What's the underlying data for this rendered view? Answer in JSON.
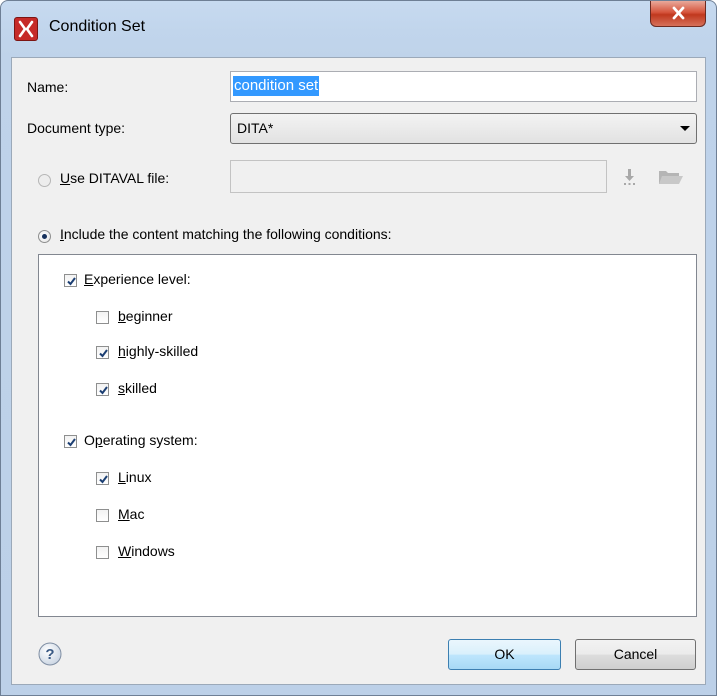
{
  "window": {
    "title": "Condition Set",
    "icons": {
      "app": "oxygen-x-icon",
      "close": "close-icon"
    }
  },
  "form": {
    "name_label": "Name:",
    "name_value": "condition set",
    "doctype_label": "Document type:",
    "doctype_value": "DITA*",
    "ditaval_label": "Use DITAVAL file:",
    "ditaval_value": "",
    "ditaval_selected": false,
    "include_label": "Include the content matching the following conditions:",
    "include_selected": true,
    "icons": {
      "download": "download-arrow-icon",
      "browse": "folder-icon"
    }
  },
  "conditions": [
    {
      "label": "Experience level:",
      "checked": true,
      "values": [
        {
          "label": "beginner",
          "checked": false
        },
        {
          "label": "highly-skilled",
          "checked": true
        },
        {
          "label": "skilled",
          "checked": true
        }
      ]
    },
    {
      "label": "Operating system:",
      "checked": true,
      "values": [
        {
          "label": "Linux",
          "checked": true
        },
        {
          "label": "Mac",
          "checked": false
        },
        {
          "label": "Windows",
          "checked": false
        }
      ]
    }
  ],
  "buttons": {
    "ok": "OK",
    "cancel": "Cancel",
    "help_icon": "help-icon"
  },
  "colors": {
    "selection": "#3399ff",
    "close_button": "#c0381e",
    "frame": "#c1d5ec",
    "check": "#1c3f73"
  }
}
